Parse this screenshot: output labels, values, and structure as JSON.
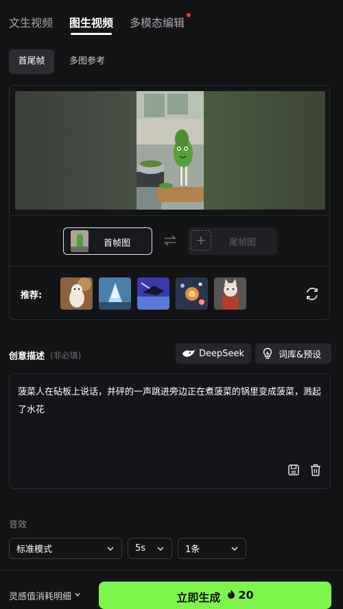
{
  "top_tabs": [
    {
      "label": "文生视频"
    },
    {
      "label": "图生视频"
    },
    {
      "label": "多模态编辑"
    }
  ],
  "sub_tabs": [
    {
      "label": "首尾帧"
    },
    {
      "label": "多图参考"
    }
  ],
  "frames": {
    "first_label": "首帧图",
    "last_label": "尾帧图",
    "swap_icon": "swap-arrows-icon",
    "add_icon": "plus-icon"
  },
  "recommend": {
    "label": "推荐:",
    "refresh_icon": "refresh-icon",
    "thumbs": [
      "thumb-ferret",
      "thumb-crystal",
      "thumb-dragon",
      "thumb-fireworks",
      "thumb-cat-warrior"
    ]
  },
  "description": {
    "title": "创意描述",
    "hint": "(非必填)",
    "deepseek_label": "DeepSeek",
    "library_label": "词库&预设",
    "text": "菠菜人在砧板上说话，并砰的一声跳进旁边正在煮菠菜的锅里变成菠菜，溅起了水花",
    "save_icon": "save-icon",
    "delete_icon": "trash-icon"
  },
  "sound": {
    "label": "音效"
  },
  "selects": {
    "mode": "标准模式",
    "duration": "5s",
    "count": "1条"
  },
  "footer": {
    "consumption_label": "灵感值消耗明细",
    "generate_label": "立即生成",
    "cost": "20"
  },
  "colors": {
    "background": "#131416",
    "accent_green": "#7ef54a",
    "badge_red": "#f2363b"
  }
}
